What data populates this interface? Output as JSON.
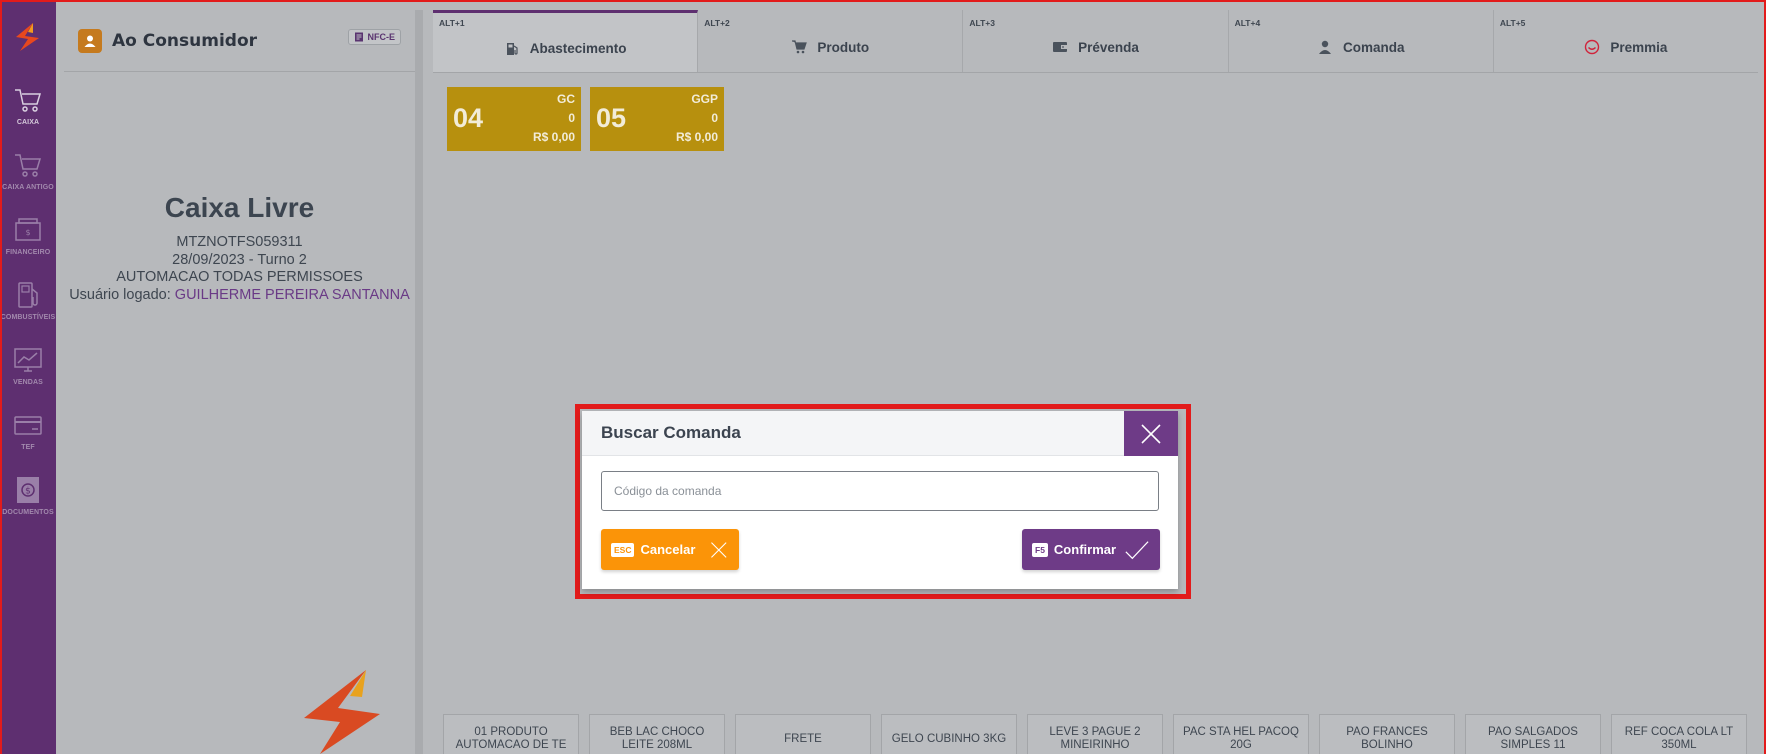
{
  "sidebar": {
    "items": [
      {
        "label": "CAIXA",
        "icon": "cart-icon"
      },
      {
        "label": "CAIXA ANTIGO",
        "icon": "cart-icon"
      },
      {
        "label": "FINANCEIRO",
        "icon": "cash-register-icon"
      },
      {
        "label": "COMBUSTÍVEIS",
        "icon": "fuel-pump-icon"
      },
      {
        "label": "VENDAS",
        "icon": "sales-chart-icon"
      },
      {
        "label": "TEF",
        "icon": "credit-card-icon"
      },
      {
        "label": "DOCUMENTOS",
        "icon": "document-money-icon"
      }
    ]
  },
  "customer": {
    "name": "Ao Consumidor",
    "badge": "NFC-E"
  },
  "caixa": {
    "title": "Caixa Livre",
    "terminal": "MTZNOTFS059311",
    "date_turno": "28/09/2023 - Turno 2",
    "permission": "AUTOMACAO TODAS PERMISSOES",
    "user_prefix": "Usuário logado:",
    "user_name": "GUILHERME PEREIRA SANTANNA"
  },
  "tabs": [
    {
      "shortcut": "ALT+1",
      "label": "Abastecimento",
      "icon": "fuel-pump-icon"
    },
    {
      "shortcut": "ALT+2",
      "label": "Produto",
      "icon": "cart-icon"
    },
    {
      "shortcut": "ALT+3",
      "label": "Prévenda",
      "icon": "wallet-icon"
    },
    {
      "shortcut": "ALT+4",
      "label": "Comanda",
      "icon": "user-icon"
    },
    {
      "shortcut": "ALT+5",
      "label": "Premmia",
      "icon": "premmia-logo-icon"
    }
  ],
  "pumps": [
    {
      "number": "04",
      "fuel": "GC",
      "qty": "0",
      "value": "R$ 0,00"
    },
    {
      "number": "05",
      "fuel": "GGP",
      "qty": "0",
      "value": "R$ 0,00"
    }
  ],
  "quick_products": [
    "01 PRODUTO AUTOMACAO DE TE",
    "BEB LAC CHOCO LEITE 208ML",
    "FRETE",
    "GELO CUBINHO 3KG",
    "LEVE 3 PAGUE 2 MINEIRINHO",
    "PAC STA HEL PACOQ 20G",
    "PAO FRANCES BOLINHO",
    "PAO SALGADOS SIMPLES 11",
    "REF COCA COLA LT 350ML"
  ],
  "modal": {
    "title": "Buscar Comanda",
    "input_placeholder": "Código da comanda",
    "cancel_key": "ESC",
    "cancel_label": "Cancelar",
    "confirm_key": "F5",
    "confirm_label": "Confirmar"
  },
  "colors": {
    "sidebar": "#5e2f70",
    "accent_purple": "#6e3b87",
    "cancel_orange": "#fb9408",
    "pump_gold": "#b7900e",
    "highlight_red": "#e21b1b"
  }
}
